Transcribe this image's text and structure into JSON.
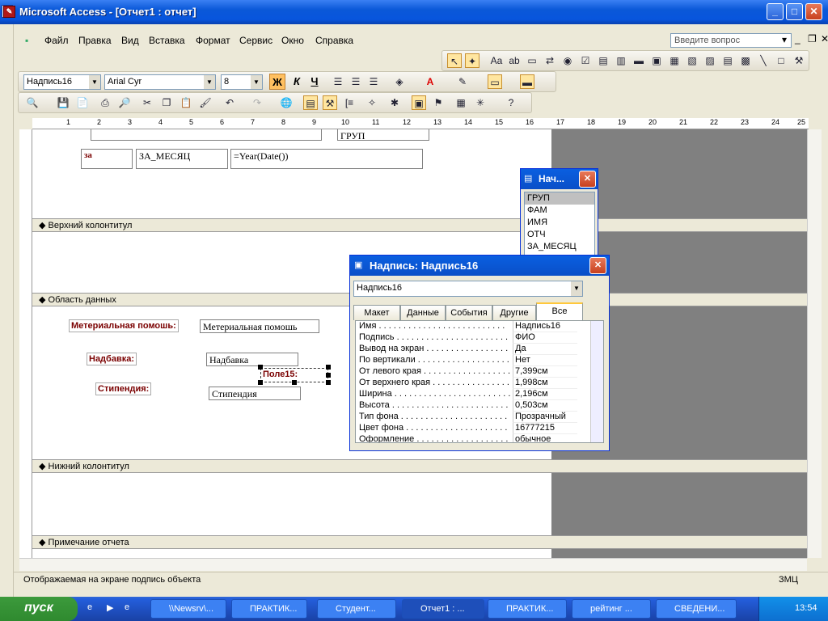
{
  "window": {
    "title": "Microsoft Access - [Отчет1 : отчет]"
  },
  "menu": {
    "items": [
      "Файл",
      "Правка",
      "Вид",
      "Вставка",
      "Формат",
      "Сервис",
      "Окно",
      "Справка"
    ],
    "ask_placeholder": "Введите вопрос"
  },
  "format_toolbar": {
    "object": "Надпись16",
    "font": "Arial Cyr",
    "size": "8",
    "bold": "Ж",
    "italic": "К",
    "underline": "Ч"
  },
  "ruler": {
    "marks": [
      "1",
      "2",
      "3",
      "4",
      "5",
      "6",
      "7",
      "8",
      "9",
      "10",
      "11",
      "12",
      "13",
      "14",
      "15",
      "16",
      "17",
      "18",
      "19",
      "20",
      "21",
      "22",
      "23",
      "24",
      "25"
    ]
  },
  "sections": {
    "page_header": "Верхний колонтитул",
    "detail": "Область данных",
    "page_footer": "Нижний колонтитул",
    "report_footer": "Примечание отчета"
  },
  "report_header_controls": {
    "za_label": "за",
    "za_mesyac": "ЗА_МЕСЯЦ",
    "year_expr": "=Year(Date())",
    "grup": "ГРУП"
  },
  "detail_controls": {
    "aid_label": "Метериальная помошь:",
    "aid_field": "Метериальная помошь",
    "bonus_label": "Надбавка:",
    "bonus_field": "Надбавка",
    "pole15": "Поле15:",
    "stipend_label": "Стипендия:",
    "stipend_field": "Стипендия"
  },
  "field_list": {
    "title": "Нач...",
    "fields": [
      "ГРУП",
      "ФАМ",
      "ИМЯ",
      "ОТЧ",
      "ЗА_МЕСЯЦ"
    ]
  },
  "properties": {
    "title": "Надпись: Надпись16",
    "selected": "Надпись16",
    "tabs": [
      "Макет",
      "Данные",
      "События",
      "Другие",
      "Все"
    ],
    "active_tab": "Все",
    "rows": [
      {
        "name": "Имя . . . . . . . . . . . . . . . . . . . . . . . . . .",
        "value": "Надпись16"
      },
      {
        "name": "Подпись . . . . . . . . . . . . . . . . . . . . . . . .",
        "value": "ФИО"
      },
      {
        "name": "Вывод на экран . . . . . . . . . . . . . . . . . .",
        "value": "Да"
      },
      {
        "name": "По вертикали . . . . . . . . . . . . . . . . . . . .",
        "value": "Нет"
      },
      {
        "name": "От левого края . . . . . . . . . . . . . . . . . .",
        "value": "7,399см"
      },
      {
        "name": "От верхнего края . . . . . . . . . . . . . . . .",
        "value": "1,998см"
      },
      {
        "name": "Ширина . . . . . . . . . . . . . . . . . . . . . . . .",
        "value": "2,196см"
      },
      {
        "name": "Высота . . . . . . . . . . . . . . . . . . . . . . . .",
        "value": "0,503см"
      },
      {
        "name": "Тип фона . . . . . . . . . . . . . . . . . . . . . .",
        "value": "Прозрачный"
      },
      {
        "name": "Цвет фона . . . . . . . . . . . . . . . . . . . . .",
        "value": "16777215"
      },
      {
        "name": "Оформление . . . . . . . . . . . . . . . . . . . .",
        "value": "обычное"
      }
    ]
  },
  "status": {
    "text": "Отображаемая на экране подпись объекта",
    "mode": "ЗМЦ"
  },
  "taskbar": {
    "start": "пуск",
    "tasks": [
      "\\\\Newsrv\\...",
      "ПРАКТИК...",
      "Студент...",
      "Отчет1 : ...",
      "ПРАКТИК...",
      "рейтинг ...",
      "СВЕДЕНИ..."
    ],
    "active_index": 3,
    "clock": "13:54"
  }
}
